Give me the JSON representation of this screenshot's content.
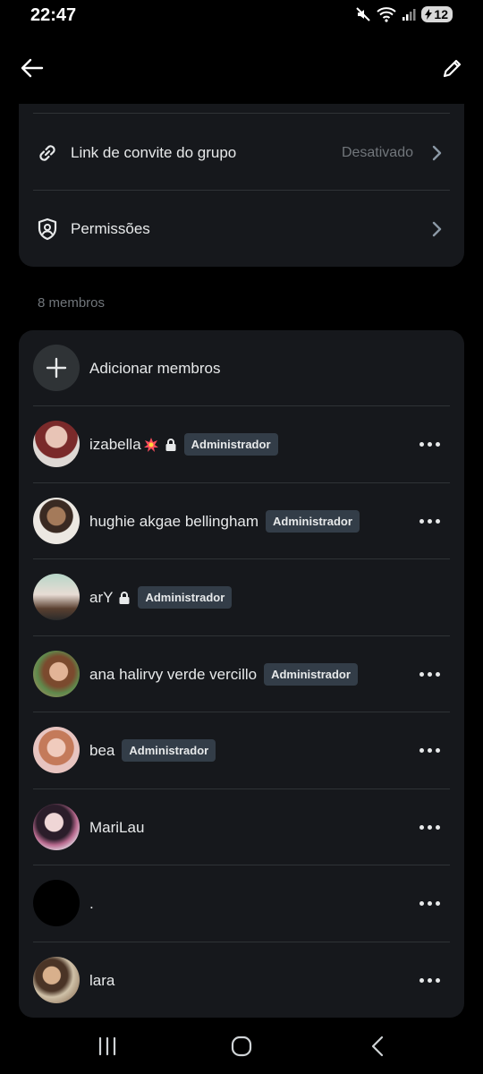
{
  "status_bar": {
    "time": "22:47",
    "battery": "12",
    "icons": [
      "mute-icon",
      "wifi-icon",
      "signal-icon",
      "battery-icon"
    ]
  },
  "topbar": {
    "back_icon": "arrow-left-icon",
    "edit_icon": "pencil-icon"
  },
  "settings": [
    {
      "label": "Link de convite do grupo",
      "value": "Desativado",
      "icon": "link-icon"
    },
    {
      "label": "Permissões",
      "value": "",
      "icon": "shield-person-icon"
    }
  ],
  "members_count": "8 membros",
  "add_members": {
    "label": "Adicionar membros",
    "icon": "plus-icon"
  },
  "badge_label": "Administrador",
  "members": [
    {
      "name": "izabella",
      "emoji_icon": "explosion-icon",
      "locked": true,
      "admin": true,
      "more": true,
      "avatar_color": "#c88a8a"
    },
    {
      "name": "hughie akgae bellingham",
      "locked": false,
      "admin": true,
      "more": true,
      "avatar_color": "#d7d1c6"
    },
    {
      "name": "arY",
      "locked": true,
      "admin": true,
      "more": false,
      "avatar_color": "#8fa89a"
    },
    {
      "name": "ana halirvy verde vercillo",
      "locked": false,
      "admin": true,
      "more": true,
      "avatar_color": "#c99a7a"
    },
    {
      "name": "bea",
      "locked": false,
      "admin": true,
      "more": true,
      "avatar_color": "#d9a7a0"
    },
    {
      "name": "MariLau",
      "locked": false,
      "admin": false,
      "more": true,
      "avatar_color": "#9c7fa0"
    },
    {
      "name": ".",
      "locked": false,
      "admin": false,
      "more": true,
      "avatar_color": "#000000"
    },
    {
      "name": "lara",
      "locked": false,
      "admin": false,
      "more": true,
      "avatar_color": "#a88b70"
    }
  ],
  "navbar": [
    "recent-apps-icon",
    "home-icon",
    "back-icon"
  ]
}
